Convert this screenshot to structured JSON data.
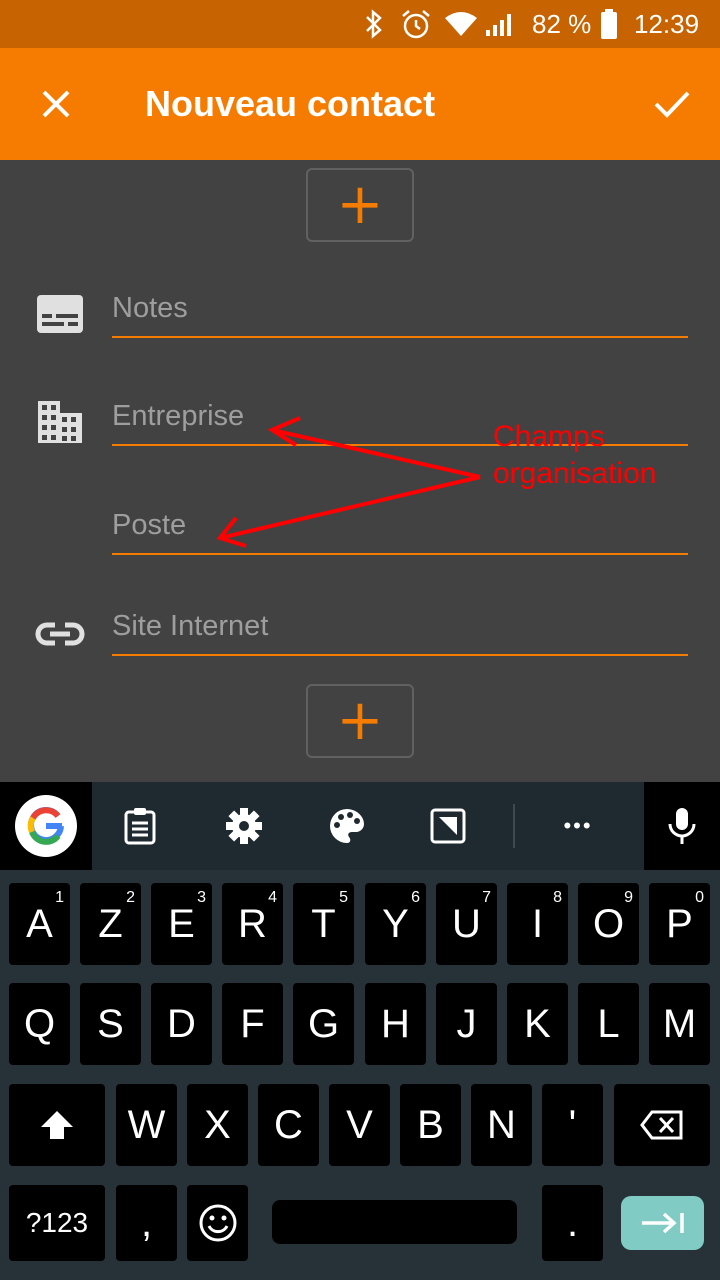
{
  "status_bar": {
    "battery_percent": "82 %",
    "time": "12:39"
  },
  "app_bar": {
    "title": "Nouveau contact"
  },
  "form": {
    "add_label": "+",
    "notes_placeholder": "Notes",
    "entreprise_placeholder": "Entreprise",
    "poste_placeholder": "Poste",
    "site_placeholder": "Site Internet"
  },
  "annotation": {
    "line1": "Champs",
    "line2": "organisation",
    "color": "#ff0000"
  },
  "keyboard": {
    "toolbar_more": "•••",
    "row1": [
      {
        "label": "A",
        "hint": "1"
      },
      {
        "label": "Z",
        "hint": "2"
      },
      {
        "label": "E",
        "hint": "3"
      },
      {
        "label": "R",
        "hint": "4"
      },
      {
        "label": "T",
        "hint": "5"
      },
      {
        "label": "Y",
        "hint": "6"
      },
      {
        "label": "U",
        "hint": "7"
      },
      {
        "label": "I",
        "hint": "8"
      },
      {
        "label": "O",
        "hint": "9"
      },
      {
        "label": "P",
        "hint": "0"
      }
    ],
    "row2": [
      "Q",
      "S",
      "D",
      "F",
      "G",
      "H",
      "J",
      "K",
      "L",
      "M"
    ],
    "row3": [
      "W",
      "X",
      "C",
      "V",
      "B",
      "N",
      "'"
    ],
    "symbols_label": "?123",
    "comma_label": ",",
    "period_label": "."
  },
  "colors": {
    "accent": "#f57c00",
    "status_bar": "#c76300",
    "background": "#424242",
    "keyboard_bg": "#263238",
    "enter_key": "#80cbc4"
  }
}
